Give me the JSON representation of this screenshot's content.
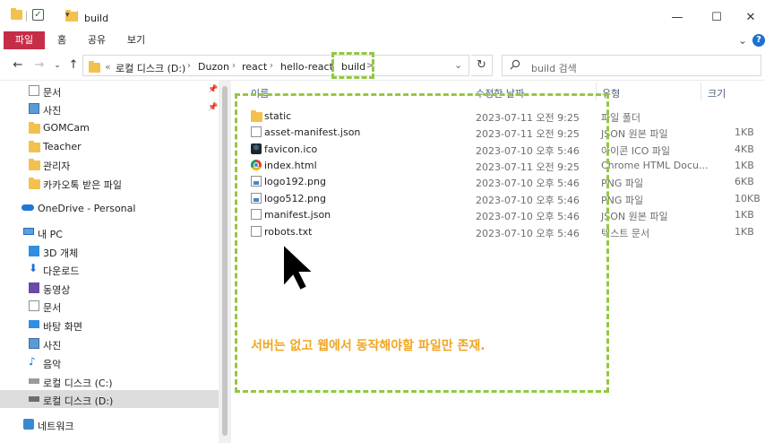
{
  "window": {
    "title": "build",
    "controls": {
      "minimize": "—",
      "maximize": "☐",
      "close": "✕"
    }
  },
  "ribbon": {
    "tabs": [
      "파일",
      "홈",
      "공유",
      "보기"
    ],
    "collapse": "⌄",
    "help": "?"
  },
  "address": {
    "prefix": "«",
    "crumbs": [
      "로컬 디스크 (D:)",
      "Duzon",
      "react",
      "hello-react",
      "build"
    ],
    "current_chevron": ">",
    "dropdown": "⌄",
    "refresh": "↻"
  },
  "search": {
    "placeholder": "build 검색"
  },
  "sidebar": {
    "quick_access": [
      {
        "label": "문서",
        "icon": "documents-icon",
        "pinned": true
      },
      {
        "label": "사진",
        "icon": "pictures-icon",
        "pinned": true
      },
      {
        "label": "GOMCam",
        "icon": "folder-icon",
        "pinned": false
      },
      {
        "label": "Teacher",
        "icon": "folder-icon",
        "pinned": false
      },
      {
        "label": "관리자",
        "icon": "folder-icon",
        "pinned": false
      },
      {
        "label": "카카오톡 받은 파일",
        "icon": "folder-icon",
        "pinned": false
      }
    ],
    "onedrive": "OneDrive - Personal",
    "this_pc": "내 PC",
    "pc_items": [
      {
        "label": "3D 개체",
        "icon": "3d-objects-icon"
      },
      {
        "label": "다운로드",
        "icon": "downloads-icon"
      },
      {
        "label": "동영상",
        "icon": "videos-icon"
      },
      {
        "label": "문서",
        "icon": "documents-icon"
      },
      {
        "label": "바탕 화면",
        "icon": "desktop-icon"
      },
      {
        "label": "사진",
        "icon": "pictures-icon"
      },
      {
        "label": "음악",
        "icon": "music-icon"
      },
      {
        "label": "로컬 디스크 (C:)",
        "icon": "drive-icon"
      },
      {
        "label": "로컬 디스크 (D:)",
        "icon": "drive-icon",
        "selected": true
      }
    ],
    "network": "네트워크"
  },
  "columns": {
    "name": "이름",
    "date": "수정한 날짜",
    "type": "유형",
    "size": "크기"
  },
  "files": [
    {
      "name": "static",
      "date": "2023-07-11 오전 9:25",
      "type": "파일 폴더",
      "size": "",
      "icon": "folder-icon"
    },
    {
      "name": "asset-manifest.json",
      "date": "2023-07-11 오전 9:25",
      "type": "JSON 원본 파일",
      "size": "1KB",
      "icon": "json-file-icon"
    },
    {
      "name": "favicon.ico",
      "date": "2023-07-10 오후 5:46",
      "type": "아이콘 ICO 파일",
      "size": "4KB",
      "icon": "react-icon"
    },
    {
      "name": "index.html",
      "date": "2023-07-11 오전 9:25",
      "type": "Chrome HTML Docu...",
      "size": "1KB",
      "icon": "chrome-icon"
    },
    {
      "name": "logo192.png",
      "date": "2023-07-10 오후 5:46",
      "type": "PNG 파일",
      "size": "6KB",
      "icon": "image-file-icon"
    },
    {
      "name": "logo512.png",
      "date": "2023-07-10 오후 5:46",
      "type": "PNG 파일",
      "size": "10KB",
      "icon": "image-file-icon"
    },
    {
      "name": "manifest.json",
      "date": "2023-07-10 오후 5:46",
      "type": "JSON 원본 파일",
      "size": "1KB",
      "icon": "json-file-icon"
    },
    {
      "name": "robots.txt",
      "date": "2023-07-10 오후 5:46",
      "type": "텍스트 문서",
      "size": "1KB",
      "icon": "text-file-icon"
    }
  ],
  "annotation": {
    "text": "서버는 없고 웹에서 동작해야할 파일만 존재.",
    "color": "#f1a623",
    "box_color": "#93c842"
  },
  "colors": {
    "file_tab": "#c52e46",
    "folder": "#f2c14e",
    "selection": "#dcdcdc"
  }
}
